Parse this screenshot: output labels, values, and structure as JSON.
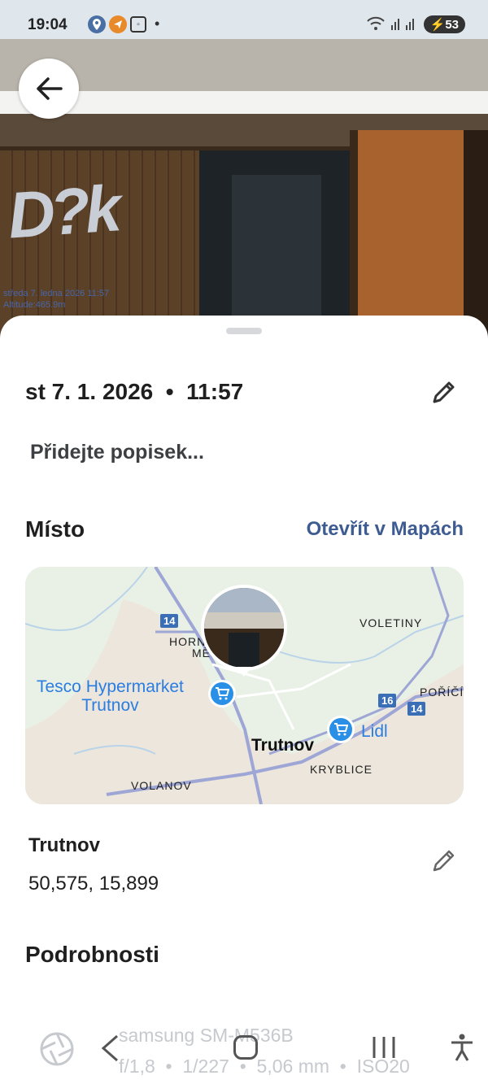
{
  "status_bar": {
    "time": "19:04",
    "battery": "53",
    "icons": [
      "location-icon",
      "telegram-icon",
      "screenshot-icon",
      "dot-icon",
      "wifi-icon",
      "signal-icon"
    ]
  },
  "photo": {
    "stamp_line1": "středa 7. ledna 2026 11:57",
    "stamp_line2": "Altitude:465.9m"
  },
  "sheet": {
    "datetime": "st 7. 1. 2026  •  11:57",
    "caption_placeholder": "Přidejte popisek...",
    "place_section_title": "Místo",
    "open_in_maps": "Otevřít v Mapách",
    "map": {
      "labels": {
        "horni": "HORNÍ",
        "mesto": "MĚ",
        "voletiny": "VOLETINY",
        "porici": "POŘÍČÍ",
        "kryblice": "KRYBLICE",
        "volanov": "VOLANOV",
        "city": "Trutnov",
        "tesco": "Tesco Hypermarket\nTrutnov",
        "lidl": "Lidl"
      },
      "shields": {
        "r14a": "14",
        "r16": "16",
        "r14b": "14"
      }
    },
    "location_name": "Trutnov",
    "location_coords": "50,575, 15,899",
    "details_title": "Podrobnosti",
    "camera_model": "samsung SM-M536B",
    "camera_params": "f/1,8  •  1/227  •  5,06 mm  •  ISO20"
  },
  "colors": {
    "accent": "#3e5c92",
    "poi_blue": "#2a8fe6",
    "map_bg": "#e7efe3"
  }
}
